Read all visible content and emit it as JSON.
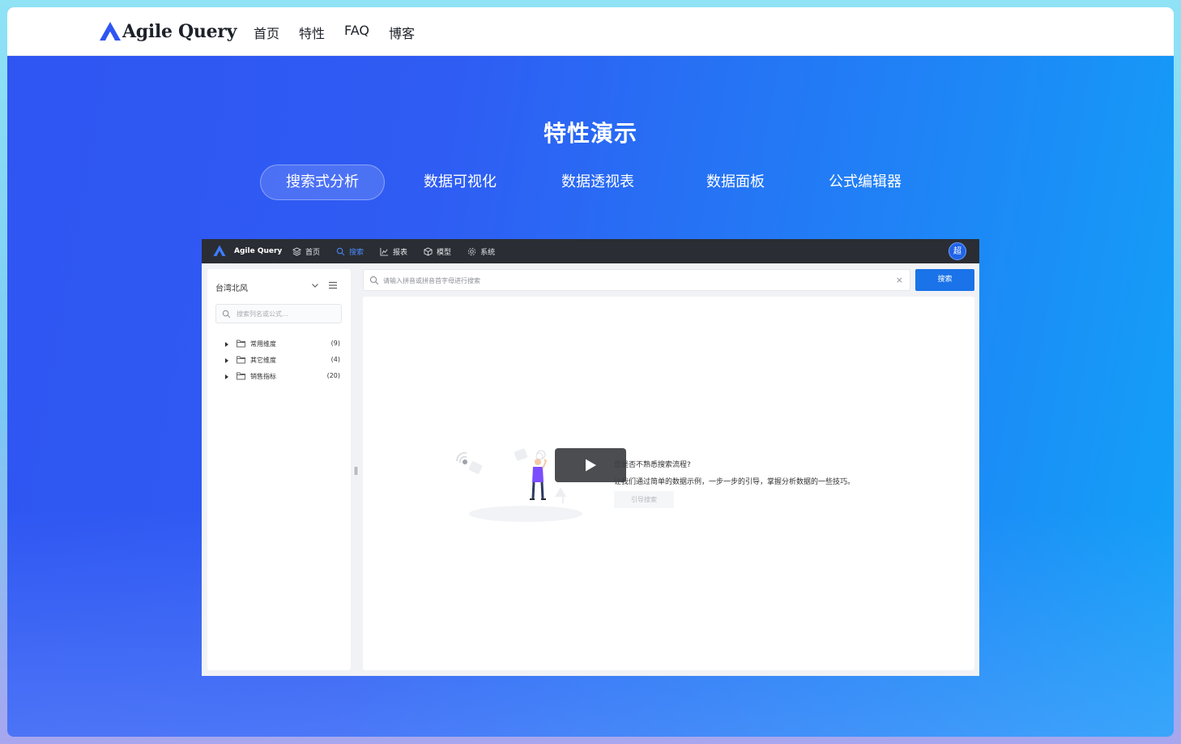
{
  "site": {
    "brand": "Agile Query",
    "nav": [
      "首页",
      "特性",
      "FAQ",
      "博客"
    ],
    "brand_color": "#2f55f2"
  },
  "features": {
    "title": "特性演示",
    "tabs": [
      "搜索式分析",
      "数据可视化",
      "数据透视表",
      "数据面板",
      "公式编辑器"
    ],
    "active_tab": "搜索式分析"
  },
  "demo": {
    "brand": "Agile Query",
    "menu": [
      {
        "label": "首页",
        "icon": "layers-icon"
      },
      {
        "label": "搜索",
        "icon": "search-icon"
      },
      {
        "label": "报表",
        "icon": "chart-icon"
      },
      {
        "label": "模型",
        "icon": "cube-icon"
      },
      {
        "label": "系统",
        "icon": "gear-icon"
      }
    ],
    "active_menu": "搜索",
    "avatar": "超",
    "sidebar": {
      "datasource": "台湾北风",
      "search_placeholder": "搜索列名或公式...",
      "folders": [
        {
          "label": "常用维度",
          "count": "(9)"
        },
        {
          "label": "其它维度",
          "count": "(4)"
        },
        {
          "label": "销售指标",
          "count": "(20)"
        }
      ]
    },
    "search": {
      "placeholder": "请输入拼音或拼音首字母进行搜索",
      "clear": "×",
      "button": "搜索"
    },
    "guide": {
      "title": "您是否不熟悉搜索流程?",
      "description": "让我们通过简单的数据示例，一步一步的引导，掌握分析数据的一些技巧。",
      "button": "引导搜索"
    },
    "accent_color": "#1a73e8"
  }
}
